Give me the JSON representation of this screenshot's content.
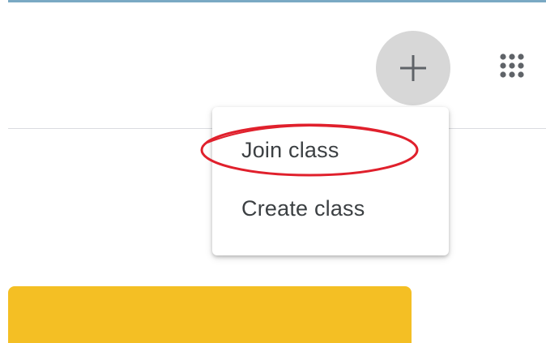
{
  "header": {
    "add_button_icon": "plus-icon",
    "apps_button_icon": "apps-grid-icon"
  },
  "menu": {
    "items": [
      {
        "label": "Join class",
        "highlighted": true
      },
      {
        "label": "Create class",
        "highlighted": false
      }
    ]
  },
  "annotation": {
    "color": "#e0202c"
  },
  "colors": {
    "card": "#f4bf24",
    "top_border": "#7aa9c4",
    "add_button_bg": "#d7d7d7"
  }
}
